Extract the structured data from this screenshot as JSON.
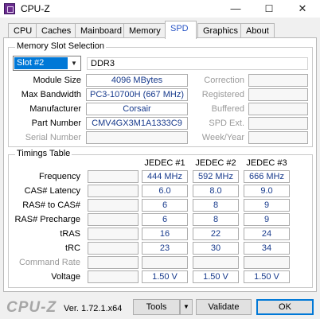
{
  "window": {
    "title": "CPU-Z",
    "minimize": "—",
    "maximize": "☐",
    "close": "✕"
  },
  "tabs": [
    {
      "label": "CPU"
    },
    {
      "label": "Caches"
    },
    {
      "label": "Mainboard"
    },
    {
      "label": "Memory"
    },
    {
      "label": "SPD"
    },
    {
      "label": "Graphics"
    },
    {
      "label": "About"
    }
  ],
  "active_tab": "SPD",
  "slot": {
    "group_title": "Memory Slot Selection",
    "selected": "Slot #2",
    "type": "DDR3",
    "labels": {
      "module_size": "Module Size",
      "max_bandwidth": "Max Bandwidth",
      "manufacturer": "Manufacturer",
      "part_number": "Part Number",
      "serial_number": "Serial Number",
      "correction": "Correction",
      "registered": "Registered",
      "buffered": "Buffered",
      "spd_ext": "SPD Ext.",
      "week_year": "Week/Year"
    },
    "values": {
      "module_size": "4096 MBytes",
      "max_bandwidth": "PC3-10700H (667 MHz)",
      "manufacturer": "Corsair",
      "part_number": "CMV4GX3M1A1333C9",
      "serial_number": ""
    }
  },
  "timings": {
    "group_title": "Timings Table",
    "columns": [
      "JEDEC #1",
      "JEDEC #2",
      "JEDEC #3"
    ],
    "rows": [
      {
        "label": "Frequency",
        "values": [
          "444 MHz",
          "592 MHz",
          "666 MHz"
        ]
      },
      {
        "label": "CAS# Latency",
        "values": [
          "6.0",
          "8.0",
          "9.0"
        ]
      },
      {
        "label": "RAS# to CAS#",
        "values": [
          "6",
          "8",
          "9"
        ]
      },
      {
        "label": "RAS# Precharge",
        "values": [
          "6",
          "8",
          "9"
        ]
      },
      {
        "label": "tRAS",
        "values": [
          "16",
          "22",
          "24"
        ]
      },
      {
        "label": "tRC",
        "values": [
          "23",
          "30",
          "34"
        ]
      },
      {
        "label": "Command Rate",
        "values": [
          "",
          "",
          ""
        ]
      },
      {
        "label": "Voltage",
        "values": [
          "1.50 V",
          "1.50 V",
          "1.50 V"
        ]
      }
    ]
  },
  "footer": {
    "logo": "CPU-Z",
    "version": "Ver. 1.72.1.x64",
    "tools": "Tools",
    "validate": "Validate",
    "ok": "OK"
  }
}
